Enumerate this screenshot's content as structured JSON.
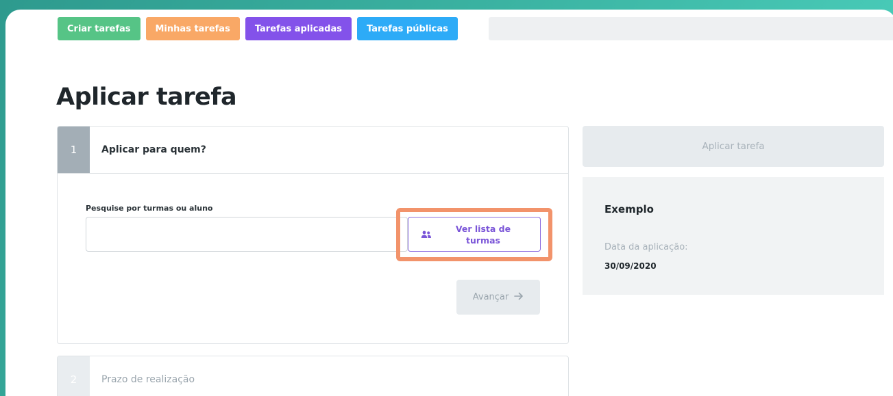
{
  "tabs": [
    {
      "label": "Criar tarefas",
      "color": "#56c486"
    },
    {
      "label": "Minhas tarefas",
      "color": "#f9a866"
    },
    {
      "label": "Tarefas aplicadas",
      "color": "#8352ea"
    },
    {
      "label": "Tarefas públicas",
      "color": "#2dabf7"
    }
  ],
  "page_title": "Aplicar tarefa",
  "step1": {
    "number": "1",
    "title": "Aplicar para quem?",
    "search_label": "Pesquise por turmas ou aluno",
    "search_value": "",
    "search_placeholder": "",
    "list_button_label": "Ver lista de\nturmas",
    "list_button_icon": "people-icon",
    "next_button_label": "Avançar",
    "next_button_icon": "arrow-right-icon"
  },
  "step2": {
    "number": "2",
    "title": "Prazo de realização"
  },
  "apply_button_label": "Aplicar tarefa",
  "preview": {
    "title": "Exemplo",
    "date_label": "Data da aplicação:",
    "date_value": "30/09/2020"
  },
  "colors": {
    "accent_purple": "#7b56d8",
    "highlight": "#f2936b"
  }
}
